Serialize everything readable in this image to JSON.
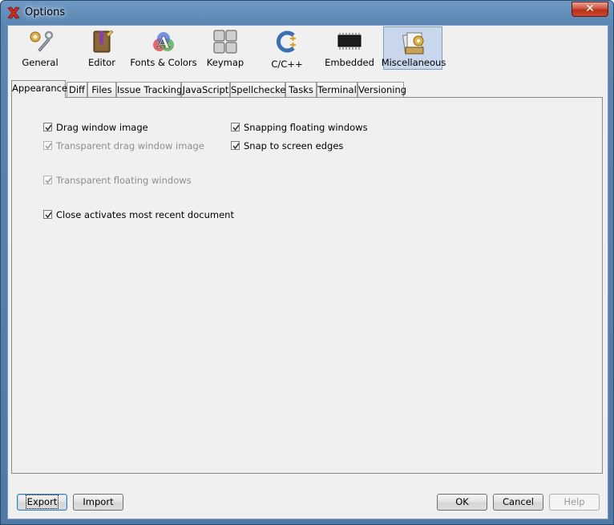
{
  "window": {
    "title": "Options",
    "close_glyph": "✕",
    "accent": "#5a86b3"
  },
  "categories": [
    {
      "label": "General",
      "icon": "wrench-gear-icon",
      "selected": false
    },
    {
      "label": "Editor",
      "icon": "notebook-pencil-icon",
      "selected": false
    },
    {
      "label": "Fonts & Colors",
      "icon": "fonts-colors-icon",
      "selected": false
    },
    {
      "label": "Keymap",
      "icon": "keyboard-keys-icon",
      "selected": false
    },
    {
      "label": "C/C++",
      "icon": "cpp-icon",
      "selected": false
    },
    {
      "label": "Embedded",
      "icon": "chip-icon",
      "selected": false
    },
    {
      "label": "Miscellaneous",
      "icon": "misc-gears-icon",
      "selected": true
    }
  ],
  "tabs": [
    "Appearance",
    "Diff",
    "Files",
    "Issue Tracking",
    "JavaScript",
    "Spellchecker",
    "Tasks",
    "Terminal",
    "Versioning"
  ],
  "active_tab": "Appearance",
  "options": {
    "drag_window_image": {
      "label": "Drag window image",
      "checked": true,
      "enabled": true
    },
    "transparent_drag": {
      "label": "Transparent drag window image",
      "checked": true,
      "enabled": false
    },
    "transparent_floating": {
      "label": "Transparent floating windows",
      "checked": true,
      "enabled": false
    },
    "close_activates": {
      "label": "Close activates most recent document",
      "checked": true,
      "enabled": true
    },
    "snapping_floating": {
      "label": "Snapping floating windows",
      "checked": true,
      "enabled": true
    },
    "snap_edges": {
      "label": "Snap to screen edges",
      "checked": true,
      "enabled": true
    }
  },
  "buttons": {
    "export": "Export",
    "import": "Import",
    "ok": "OK",
    "cancel": "Cancel",
    "help": "Help"
  }
}
